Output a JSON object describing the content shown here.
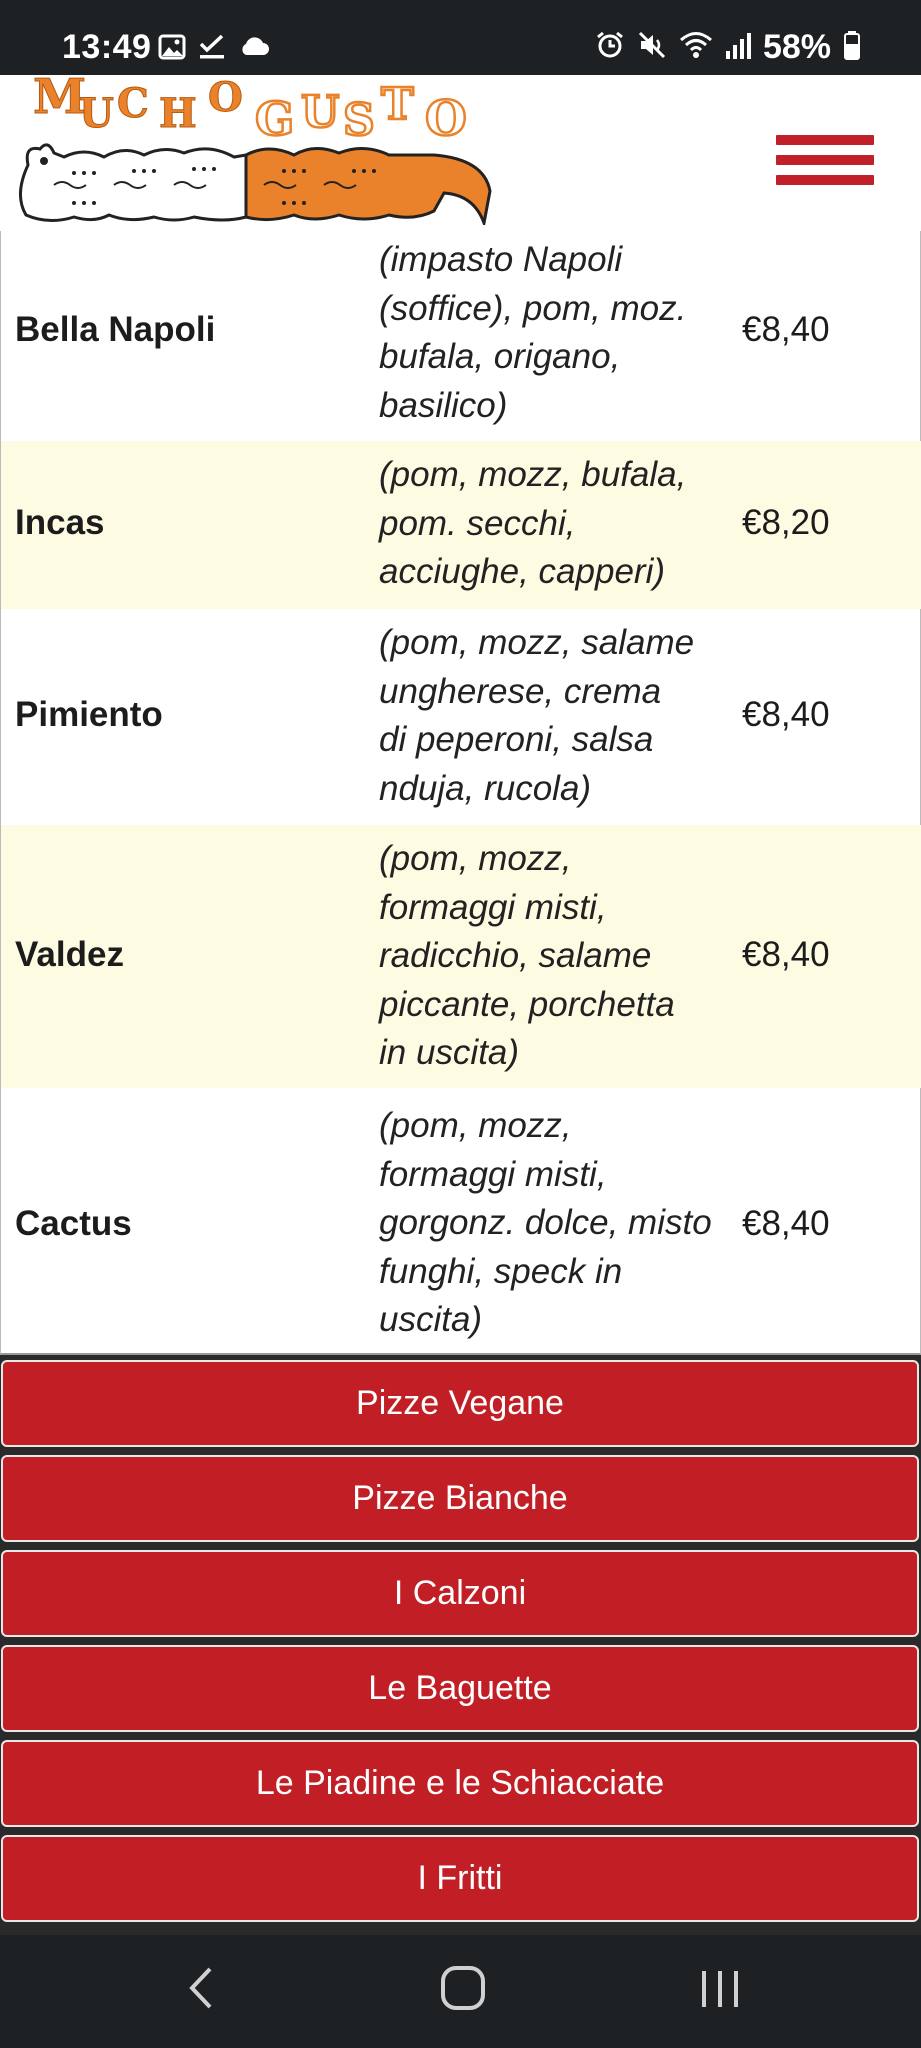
{
  "status_bar": {
    "time": "13:49",
    "battery": "58%",
    "left_icons": [
      "gallery-icon",
      "check-icon",
      "cloud-icon"
    ],
    "right_icons": [
      "alarm-icon",
      "mute-icon",
      "wifi-icon",
      "signal-icon",
      "battery-icon"
    ]
  },
  "header": {
    "logo_text": "MUCHOGUSTO",
    "logo_part1": "MUCHO",
    "logo_part2": "GUSTO",
    "colors": {
      "red": "#c0202a",
      "orange": "#e9822a"
    }
  },
  "menu": {
    "items": [
      {
        "name": "Bella Napoli",
        "desc_lines": [
          "(impasto Napoli",
          "(soffice), pom, moz.",
          "bufala, origano,",
          "basilico)"
        ],
        "price": "€8,40"
      },
      {
        "name": "Incas",
        "desc_lines": [
          "(pom, mozz, bufala,",
          "pom. secchi,",
          "acciughe, capperi)"
        ],
        "price": "€8,20"
      },
      {
        "name": "Pimiento",
        "desc_lines": [
          "(pom, mozz, salame",
          "ungherese, crema",
          "di peperoni, salsa",
          "nduja, rucola)"
        ],
        "price": "€8,40"
      },
      {
        "name": "Valdez",
        "desc_lines": [
          "(pom, mozz,",
          "formaggi misti,",
          "radicchio, salame",
          "piccante, porchetta",
          "in uscita)"
        ],
        "price": "€8,40"
      },
      {
        "name": "Cactus",
        "desc_lines": [
          "(pom, mozz,",
          "formaggi misti,",
          "gorgonz. dolce, misto",
          "funghi, speck in",
          "uscita)"
        ],
        "price": "€8,40"
      }
    ]
  },
  "categories": [
    {
      "label": "Pizze Vegane"
    },
    {
      "label": "Pizze Bianche"
    },
    {
      "label": "I Calzoni"
    },
    {
      "label": "Le Baguette"
    },
    {
      "label": "Le Piadine e le Schiacciate"
    },
    {
      "label": "I Fritti"
    }
  ],
  "nav_bar": {
    "buttons": [
      "back-icon",
      "home-icon",
      "recents-icon"
    ]
  }
}
